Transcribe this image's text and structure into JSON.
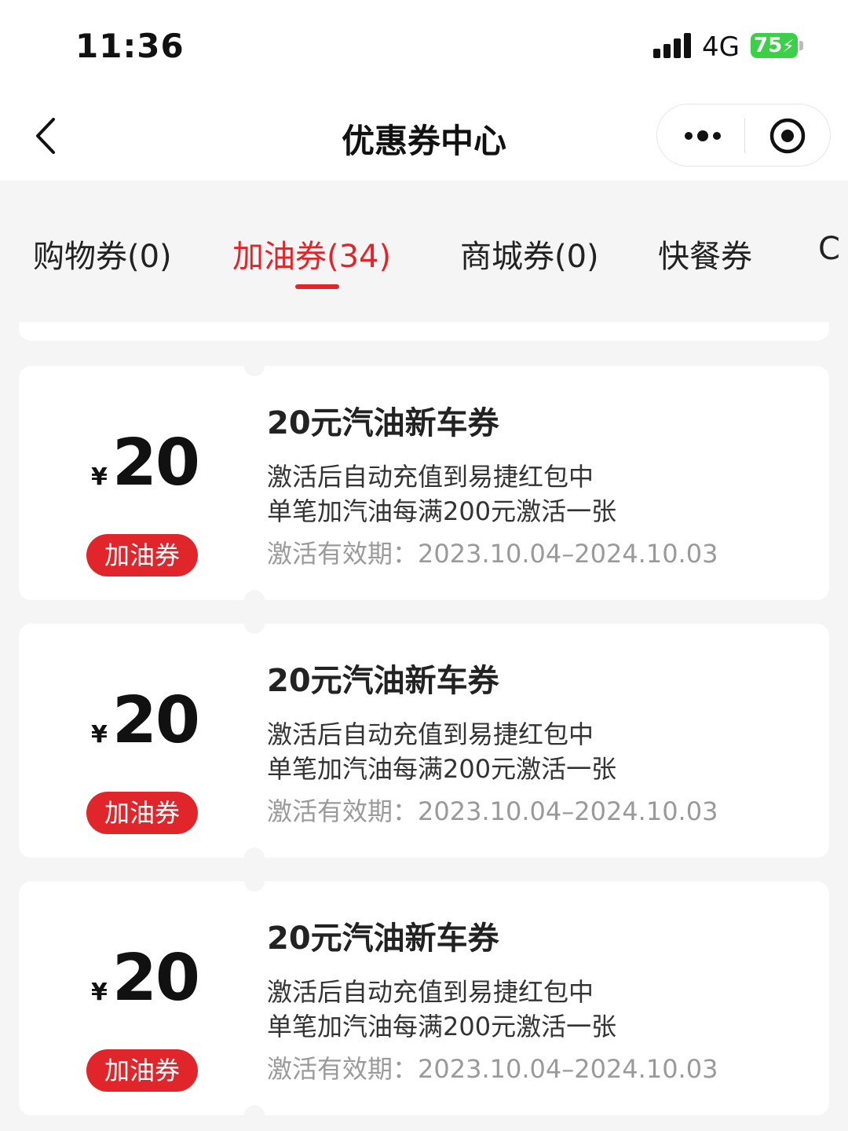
{
  "status_bar": {
    "time": "11:36",
    "network": "4G",
    "battery": "75",
    "signal_icon": "signal-bars-icon"
  },
  "header": {
    "title": "优惠券中心",
    "back_icon": "chevron-left-icon",
    "more_icon": "more-dots-icon",
    "close_icon": "target-circle-icon"
  },
  "tabs": [
    {
      "label": "购物券(0)",
      "active": false
    },
    {
      "label": "加油券(34)",
      "active": true
    },
    {
      "label": "商城券(0)",
      "active": false
    },
    {
      "label": "快餐券",
      "active": false
    },
    {
      "label": "C",
      "active": false
    }
  ],
  "accent_color": "#e0262b",
  "coupons": [
    {
      "currency": "¥",
      "amount": "20",
      "badge": "加油券",
      "title": "20元汽油新车券",
      "desc_line1": "激活后自动充值到易捷红包中",
      "desc_line2": "单笔加汽油每满200元激活一张",
      "validity": "激活有效期：2023.10.04–2024.10.03"
    },
    {
      "currency": "¥",
      "amount": "20",
      "badge": "加油券",
      "title": "20元汽油新车券",
      "desc_line1": "激活后自动充值到易捷红包中",
      "desc_line2": "单笔加汽油每满200元激活一张",
      "validity": "激活有效期：2023.10.04–2024.10.03"
    },
    {
      "currency": "¥",
      "amount": "20",
      "badge": "加油券",
      "title": "20元汽油新车券",
      "desc_line1": "激活后自动充值到易捷红包中",
      "desc_line2": "单笔加汽油每满200元激活一张",
      "validity": "激活有效期：2023.10.04–2024.10.03"
    }
  ]
}
